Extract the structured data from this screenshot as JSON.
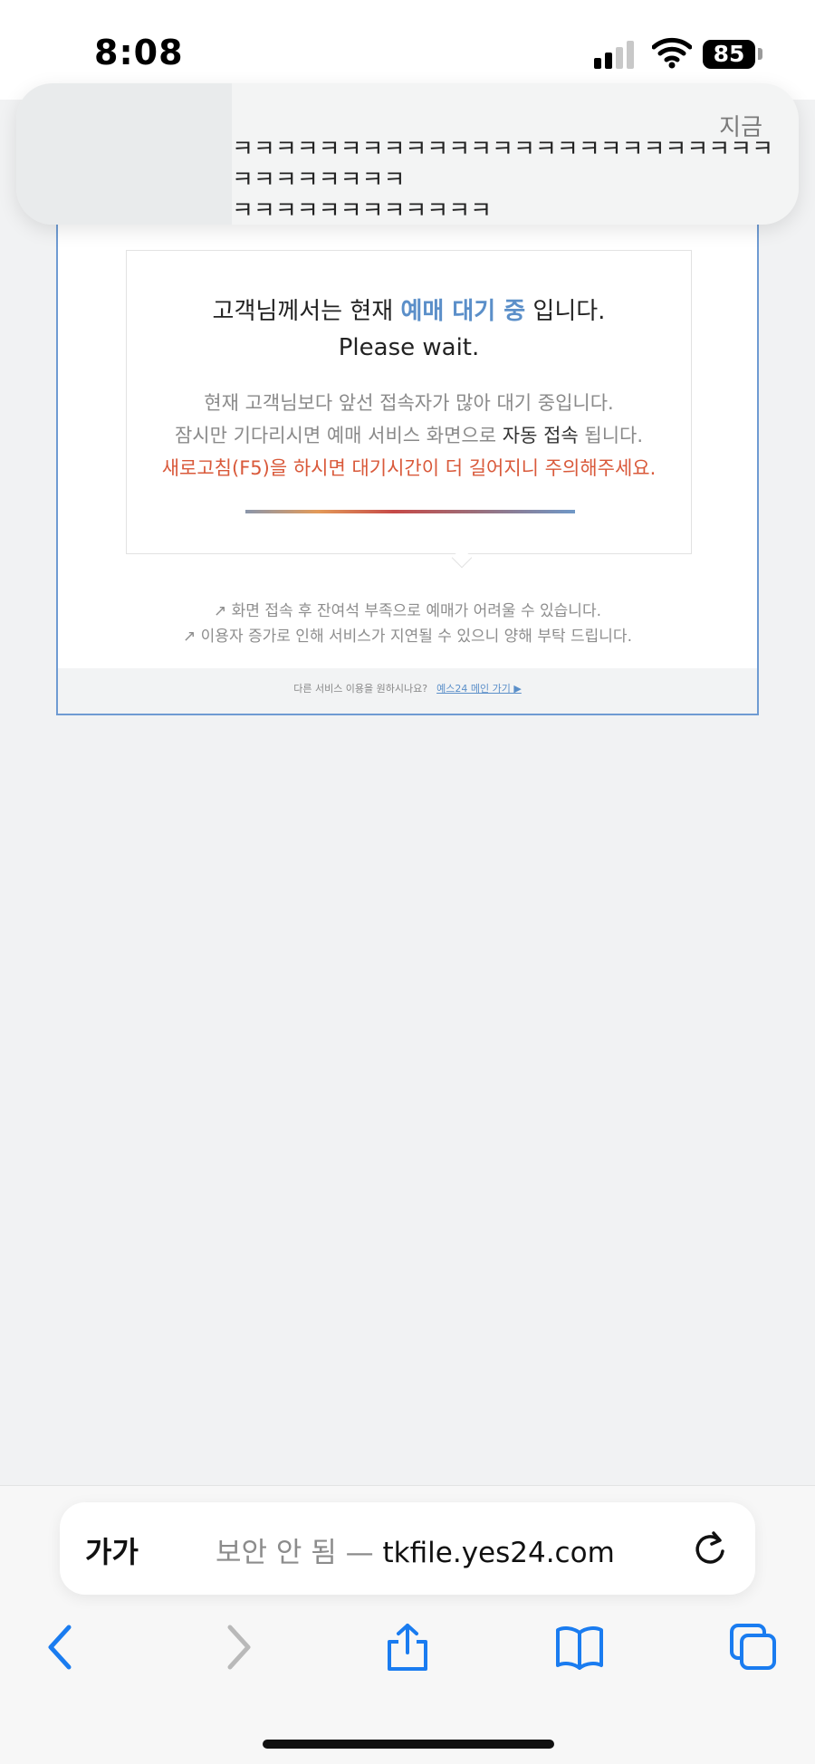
{
  "status_bar": {
    "time": "8:08",
    "battery": "85"
  },
  "notification": {
    "time": "지금",
    "message": "ㅋㅋㅋㅋㅋㅋㅋㅋㅋㅋㅋㅋㅋㅋㅋㅋㅋㅋㅋㅋㅋㅋㅋㅋㅋㅋㅋㅋㅋㅋㅋㅋㅋ\nㅋㅋㅋㅋㅋㅋㅋㅋㅋㅋㅋㅋ"
  },
  "queue": {
    "headline_prefix": "고객님께서는 현재 ",
    "headline_highlight": "예매 대기 중",
    "headline_suffix": " 입니다.",
    "subtitle": "Please wait.",
    "info_line1": "현재 고객님보다 앞선 접속자가 많아 대기 중입니다.",
    "info_line2_prefix": "잠시만 기다리시면 예매 서비스 화면으로 ",
    "info_line2_emphasis": "자동 접속",
    "info_line2_suffix": " 됩니다.",
    "warning": "새로고침(F5)을 하시면 대기시간이 더 길어지니 주의해주세요.",
    "notice1": "↗ 화면 접속 후 잔여석 부족으로 예매가 어려울 수 있습니다.",
    "notice2": "↗ 이용자 증가로 인해 서비스가 지연될 수 있으니 양해 부탁 드립니다.",
    "footer_text": "다른 서비스 이용을 원하시나요?",
    "footer_link": "예스24 메인 가기 ▶"
  },
  "browser": {
    "text_size_button": "가가",
    "security_label": "보안 안 됨",
    "separator": " — ",
    "domain": "tkfile.yes24.com"
  },
  "icons": {
    "back": "chevron-left-icon",
    "forward": "chevron-right-icon",
    "share": "share-icon",
    "bookmarks": "book-icon",
    "tabs": "tabs-icon",
    "reload": "reload-icon"
  },
  "colors": {
    "accent": "#5b8fc9",
    "warning": "#d9593a",
    "ios_blue": "#1a7cf0"
  }
}
